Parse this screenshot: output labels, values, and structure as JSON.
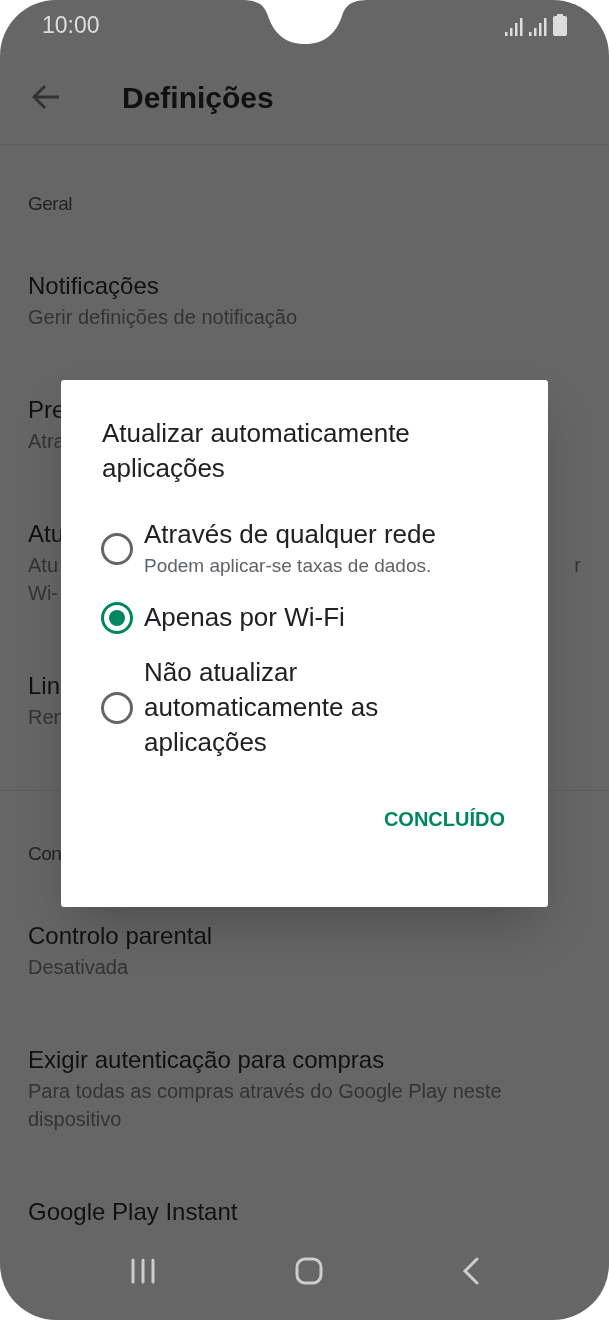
{
  "status_bar": {
    "time": "10:00"
  },
  "toolbar": {
    "title": "Definições"
  },
  "sections": [
    {
      "header": "Geral",
      "items": [
        {
          "title": "Notificações",
          "subtitle_lines": [
            "Gerir definições de notificação"
          ]
        },
        {
          "title": "Pre",
          "subtitle_lines": [
            "Atra"
          ]
        },
        {
          "title": "Atu",
          "subtitle_lines": [
            "Atu",
            "Wi-"
          ],
          "subtitle_tail": "r"
        },
        {
          "title": "Lin",
          "subtitle_lines": [
            "Ren"
          ]
        }
      ]
    },
    {
      "header": "Con",
      "items": [
        {
          "title": "Controlo parental",
          "subtitle_lines": [
            "Desativada"
          ]
        },
        {
          "title": "Exigir autenticação para compras",
          "subtitle_lines": [
            "Para todas as compras através do Google Play neste",
            "dispositivo"
          ]
        },
        {
          "title": "Google Play Instant"
        }
      ]
    }
  ],
  "dialog": {
    "title": "Atualizar automaticamente aplicações",
    "options": [
      {
        "label": "Através de qualquer rede",
        "subtitle": "Podem aplicar-se taxas de dados.",
        "selected": false
      },
      {
        "label": "Apenas por Wi-Fi",
        "selected": true
      },
      {
        "label": "Não atualizar automaticamente as aplicações",
        "selected": false
      }
    ],
    "button": "CONCLUÍDO"
  }
}
